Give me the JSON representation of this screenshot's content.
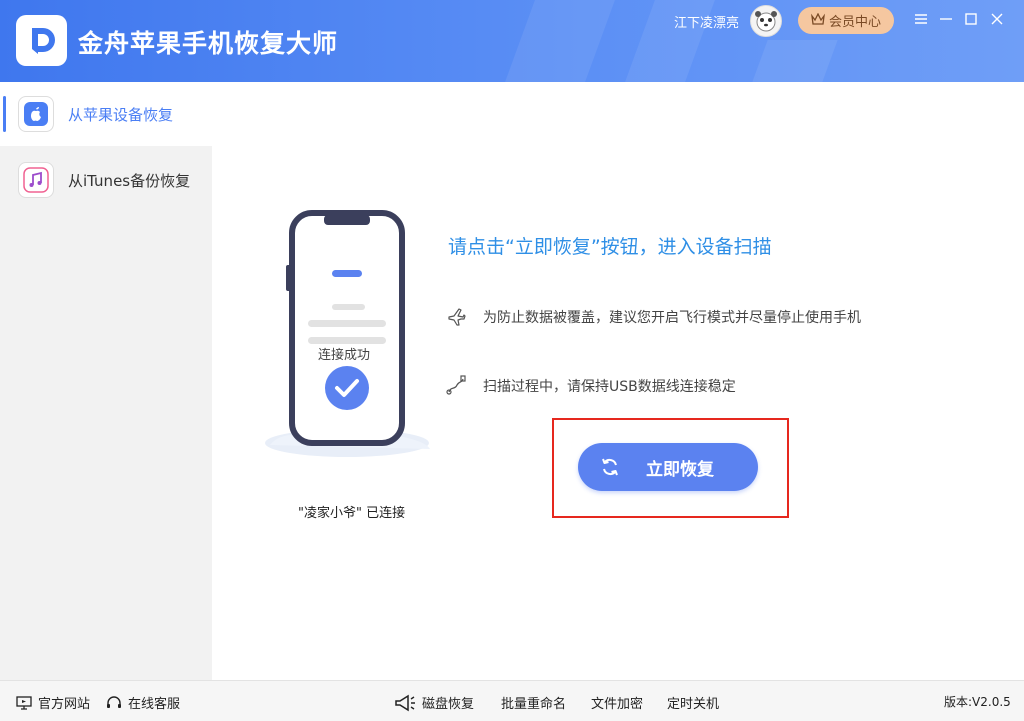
{
  "app": {
    "title": "金舟苹果手机恢复大师"
  },
  "header": {
    "username": "江下凌漂亮",
    "vip_label": "会员中心"
  },
  "sidebar": {
    "items": [
      {
        "label": "从苹果设备恢复",
        "active": true,
        "icon": "apple-icon"
      },
      {
        "label": "从iTunes备份恢复",
        "active": false,
        "icon": "music-note-icon"
      }
    ]
  },
  "main": {
    "phone_status": "连接成功",
    "device_connected": "\"凌家小爷\" 已连接",
    "title": "请点击“立即恢复”按钮，进入设备扫描",
    "tips": [
      {
        "icon": "airplane-icon",
        "text": "为防止数据被覆盖，建议您开启飞行模式并尽量停止使用手机"
      },
      {
        "icon": "usb-cable-icon",
        "text": "扫描过程中，请保持USB数据线连接稳定"
      }
    ],
    "recover_button": "立即恢复"
  },
  "statusbar": {
    "website": "官方网站",
    "support": "在线客服",
    "tools": [
      "磁盘恢复",
      "批量重命名",
      "文件加密",
      "定时关机"
    ],
    "version": "版本:V2.0.5"
  },
  "colors": {
    "accent": "#4a7ef4",
    "title_blue": "#2f8fe6",
    "highlight_red": "#e6281e",
    "vip_bg": "#f5c7a0"
  }
}
